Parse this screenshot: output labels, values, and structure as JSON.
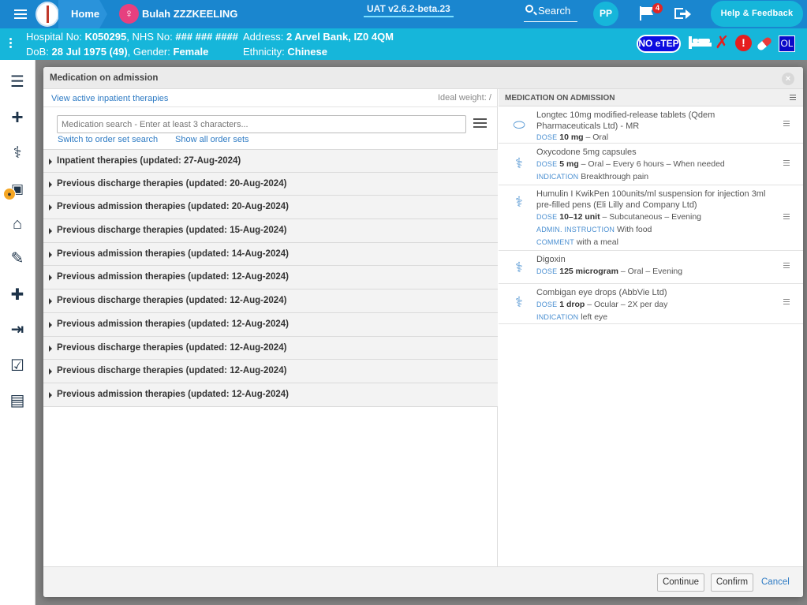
{
  "topbar": {
    "home_label": "Home",
    "patient_name": "Bulah ZZZKEELING",
    "version": "UAT v2.6.2-beta.23",
    "search_label": "Search",
    "user_initials": "PP",
    "flag_count": "4",
    "help_label": "Help & Feedback"
  },
  "patient_bar": {
    "hospital_label": "Hospital No:",
    "hospital_no": "K050295",
    "nhs_label": "NHS No:",
    "nhs_no": "### ### ####",
    "address_label": "Address:",
    "address": "2 Arvel Bank, IZ0 4QM",
    "dob_label": "DoB:",
    "dob": "28 Jul 1975 (49)",
    "gender_label": "Gender:",
    "gender": "Female",
    "ethnicity_label": "Ethnicity:",
    "ethnicity": "Chinese",
    "etep_label": "NO eTEP",
    "ol_label": "OL"
  },
  "dialog": {
    "title": "Medication on admission",
    "view_active_link": "View active inpatient therapies",
    "ideal_weight": "Ideal weight: /",
    "search_placeholder": "Medication search - Enter at least 3 characters...",
    "switch_link": "Switch to order set search",
    "show_sets_link": "Show all order sets",
    "therapy_groups": [
      "Inpatient therapies (updated: 27-Aug-2024)",
      "Previous discharge therapies (updated: 20-Aug-2024)",
      "Previous admission therapies (updated: 20-Aug-2024)",
      "Previous discharge therapies (updated: 15-Aug-2024)",
      "Previous admission therapies (updated: 14-Aug-2024)",
      "Previous admission therapies (updated: 12-Aug-2024)",
      "Previous discharge therapies (updated: 12-Aug-2024)",
      "Previous admission therapies (updated: 12-Aug-2024)",
      "Previous discharge therapies (updated: 12-Aug-2024)",
      "Previous discharge therapies (updated: 12-Aug-2024)",
      "Previous admission therapies (updated: 12-Aug-2024)"
    ],
    "right_title": "MEDICATION ON ADMISSION",
    "medications": [
      {
        "icon": "capsule-icon",
        "name": "Longtec 10mg modified-release tablets (Qdem Pharmaceuticals Ltd) - MR",
        "dose_key": "DOSE",
        "dose": "10 mg",
        "dose_rest": " – Oral"
      },
      {
        "icon": "caduceus-icon",
        "name": "Oxycodone 5mg capsules",
        "dose_key": "DOSE",
        "dose": "5 mg",
        "dose_rest": " – Oral – Every 6 hours – When needed",
        "indication_key": "INDICATION",
        "indication": "Breakthrough pain"
      },
      {
        "icon": "caduceus-icon",
        "name": "Humulin I KwikPen 100units/ml suspension for injection 3ml pre-filled pens (Eli Lilly and Company Ltd)",
        "dose_key": "DOSE",
        "dose": "10–12 unit",
        "dose_rest": " – Subcutaneous – Evening",
        "admin_key": "ADMIN. INSTRUCTION",
        "admin": "With food",
        "comment_key": "COMMENT",
        "comment": "with a meal"
      },
      {
        "icon": "caduceus-icon",
        "name": "Digoxin",
        "dose_key": "DOSE",
        "dose": "125 microgram",
        "dose_rest": " – Oral – Evening"
      },
      {
        "icon": "caduceus-icon",
        "name": "Combigan eye drops (AbbVie Ltd)",
        "dose_key": "DOSE",
        "dose": "1 drop",
        "dose_rest": " – Ocular – 2X per day",
        "indication_key": "INDICATION",
        "indication": "left eye"
      }
    ],
    "buttons": {
      "continue": "Continue",
      "confirm": "Confirm",
      "cancel": "Cancel"
    }
  },
  "colors": {
    "topbar": "#1a86cf",
    "patient_bar": "#16b6da",
    "link": "#2e7bc4",
    "etep": "#0c0ce0",
    "alert": "#e61e1e"
  }
}
